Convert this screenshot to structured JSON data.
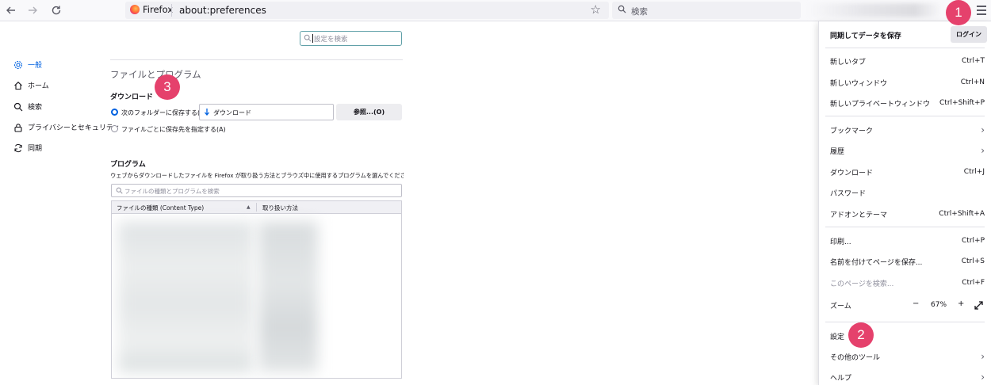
{
  "toolbar": {
    "back_icon": "arrow-left-icon",
    "forward_icon": "arrow-right-icon",
    "reload_icon": "reload-icon",
    "brand_name": "Firefox",
    "url": "about:preferences",
    "search_placeholder": "検索"
  },
  "settings_search": {
    "placeholder": "設定を検索"
  },
  "sidebar": {
    "items": [
      {
        "label": "一般",
        "icon": "gear-icon",
        "active": true
      },
      {
        "label": "ホーム",
        "icon": "home-icon"
      },
      {
        "label": "検索",
        "icon": "search-icon"
      },
      {
        "label": "プライバシーとセキュリティ",
        "icon": "lock-icon"
      },
      {
        "label": "同期",
        "icon": "sync-icon"
      }
    ]
  },
  "main": {
    "section_title": "ファイルとプログラム",
    "downloads": {
      "heading": "ダウンロード",
      "save_to_label": "次のフォルダーに保存する(V)",
      "folder_name": "ダウンロード",
      "browse_label": "参照...(O)",
      "ask_label": "ファイルごとに保存先を指定する(A)"
    },
    "programs": {
      "heading": "プログラム",
      "description": "ウェブからダウンロードしたファイルを Firefox が取り扱う方法とブラウズ中に使用するプログラムを選んでください。",
      "search_placeholder": "ファイルの種類とプログラムを検索",
      "col_type": "ファイルの種類 (Content Type)",
      "col_action": "取り扱い方法"
    }
  },
  "menu": {
    "sync_title": "同期してデータを保存",
    "login_label": "ログイン",
    "items": [
      {
        "label": "新しいタブ",
        "shortcut": "Ctrl+T"
      },
      {
        "label": "新しいウィンドウ",
        "shortcut": "Ctrl+N"
      },
      {
        "label": "新しいプライベートウィンドウ",
        "shortcut": "Ctrl+Shift+P"
      },
      {
        "label": "ブックマーク"
      },
      {
        "label": "履歴"
      },
      {
        "label": "ダウンロード",
        "shortcut": "Ctrl+J"
      },
      {
        "label": "パスワード"
      },
      {
        "label": "アドオンとテーマ",
        "shortcut": "Ctrl+Shift+A"
      },
      {
        "label": "印刷...",
        "shortcut": "Ctrl+P"
      },
      {
        "label": "名前を付けてページを保存...",
        "shortcut": "Ctrl+S"
      },
      {
        "label": "このページを検索...",
        "shortcut": "Ctrl+F"
      },
      {
        "label": "ズーム"
      },
      {
        "label": "設定"
      },
      {
        "label": "その他のツール"
      },
      {
        "label": "ヘルプ"
      }
    ],
    "zoom": {
      "minus": "−",
      "level": "67%",
      "plus": "+"
    }
  },
  "badges": {
    "one": "1",
    "two": "2",
    "three": "3"
  },
  "colors": {
    "accent": "#0061e0",
    "badge": "#e5416c"
  }
}
